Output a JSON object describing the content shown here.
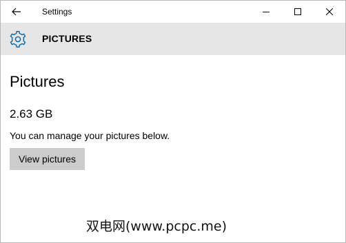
{
  "window": {
    "title": "Settings"
  },
  "header": {
    "title": "PICTURES",
    "icon": "gear-icon"
  },
  "main": {
    "heading": "Pictures",
    "size": "2.63 GB",
    "description": "You can manage your pictures below.",
    "view_button_label": "View pictures"
  },
  "watermark": {
    "text": "双电网(www.pcpc.me)"
  },
  "colors": {
    "accent": "#0063b1",
    "header_bg": "#e6e6e6",
    "button_bg": "#cccccc"
  }
}
